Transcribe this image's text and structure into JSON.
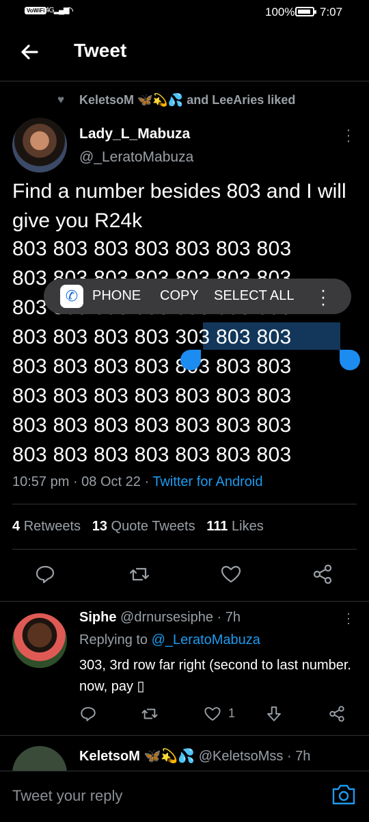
{
  "status_bar": {
    "network": "VoWiFi",
    "signal": "4G",
    "battery": "100%",
    "time": "7:07"
  },
  "header": {
    "title": "Tweet"
  },
  "social_context": {
    "text": "KeletsoM 🦋💫💦 and LeeAries liked"
  },
  "tweet": {
    "author_name": "Lady_L_Mabuza",
    "author_handle": "@_LeratoMabuza",
    "intro_text": "Find a number besides 803 and I will give you R24k",
    "number_rows": [
      "803 803 803 803 803 803 803",
      "803 803 803 803 803 803 803",
      "803 803 803 803 803 803 803",
      "803 803 803 803 303 803 803",
      "803 803 803 803 803 803 803",
      "803 803 803 803 803 803 803",
      "803 803 803 803 803 803 803",
      "803 803 803 803 803 803 803"
    ],
    "time": "10:57 pm",
    "date": "08 Oct 22",
    "source": "Twitter for Android",
    "retweets": "4",
    "retweets_label": "Retweets",
    "quote_tweets": "13",
    "quote_tweets_label": "Quote Tweets",
    "likes": "111",
    "likes_label": "Likes"
  },
  "context_menu": {
    "phone": "PHONE",
    "copy": "COPY",
    "select_all": "SELECT ALL"
  },
  "selection": {
    "selected_text": "303 803 803"
  },
  "reply": {
    "name": "Siphe",
    "handle": "@drnursesiphe",
    "age": "7h",
    "replying_prefix": "Replying to",
    "replying_to": "@_LeratoMabuza",
    "text": "303, 3rd row far right (second to last number. now, pay ▯",
    "like_count": "1"
  },
  "next_reply": {
    "name": "KeletsoM 🦋💫💦",
    "handle": "@KeletsoMss",
    "age": "7h"
  },
  "composer": {
    "placeholder": "Tweet your reply"
  },
  "colors": {
    "accent": "#1d9bf0",
    "background": "#000000",
    "muted": "#9aa0a6",
    "selection": "#12375a"
  }
}
